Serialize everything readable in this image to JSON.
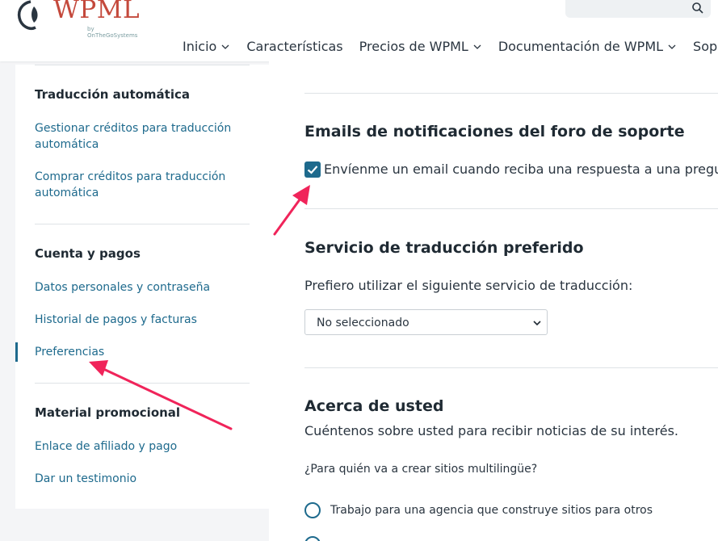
{
  "header": {
    "logo_text": "WPML",
    "logo_sub": "by OnTheGoSystems",
    "nav": [
      {
        "label": "Inicio",
        "has_dropdown": true
      },
      {
        "label": "Características",
        "has_dropdown": false
      },
      {
        "label": "Precios de WPML",
        "has_dropdown": true
      },
      {
        "label": "Documentación de WPML",
        "has_dropdown": true
      },
      {
        "label": "Soporte",
        "has_dropdown": false
      }
    ],
    "search_icon": "search-icon"
  },
  "sidebar": {
    "sections": [
      {
        "heading": "Traducción automática",
        "links": [
          "Gestionar créditos para traducción automática",
          "Comprar créditos para traducción automática"
        ]
      },
      {
        "heading": "Cuenta y pagos",
        "links": [
          "Datos personales y contraseña",
          "Historial de pagos y facturas",
          "Preferencias"
        ]
      },
      {
        "heading": "Material promocional",
        "links": [
          "Enlace de afiliado y pago",
          "Dar un testimonio"
        ]
      }
    ],
    "active_link": "Preferencias"
  },
  "main": {
    "emails": {
      "heading": "Emails de notificaciones del foro de soporte",
      "checkbox_label": "Envíenme un email cuando reciba una respuesta a una pregunta",
      "checked": true
    },
    "translation_service": {
      "heading": "Servicio de traducción preferido",
      "prompt": "Prefiero utilizar el siguiente servicio de traducción:",
      "selected": "No seleccionado"
    },
    "about": {
      "heading": "Acerca de usted",
      "description": "Cuéntenos sobre usted para recibir noticias de su interés.",
      "question": "¿Para quién va a crear sitios multilingüe?",
      "options": [
        "Trabajo para una agencia que construye sitios para otros"
      ]
    }
  },
  "colors": {
    "accent": "#1e6a8d",
    "logo": "#c4493c",
    "annotation_arrow": "#f0245a"
  }
}
